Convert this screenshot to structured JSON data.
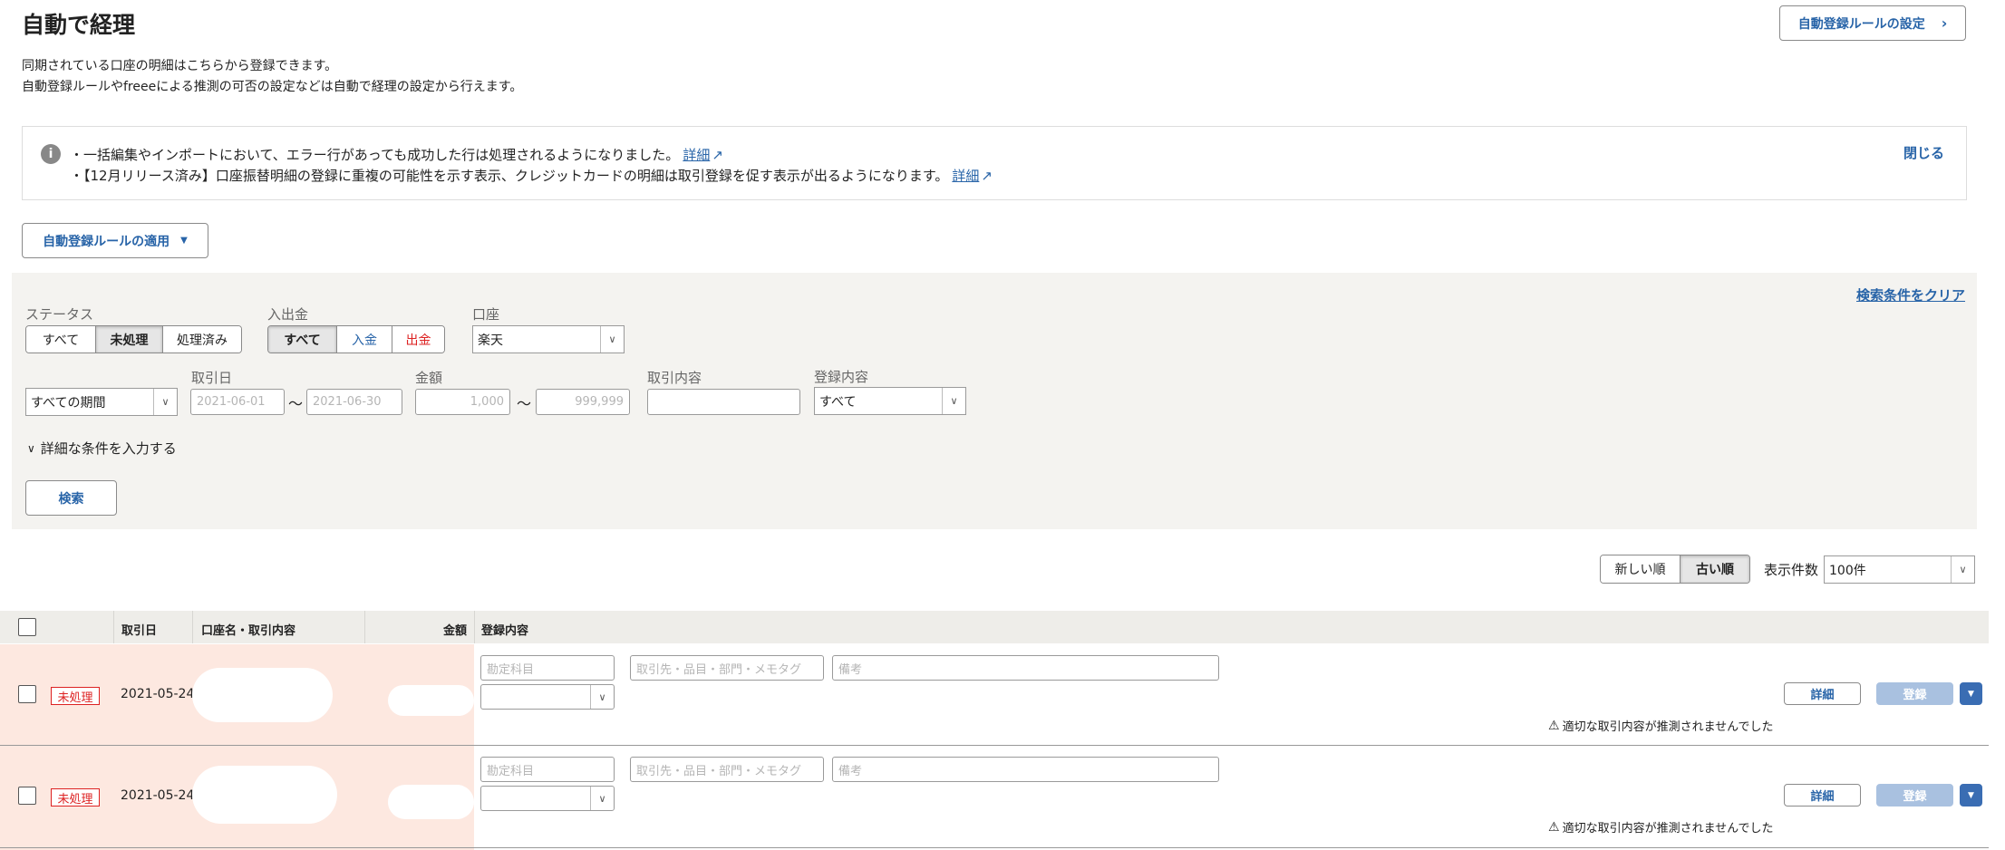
{
  "header": {
    "title": "自動で経理",
    "desc1": "同期されている口座の明細はこちらから登録できます。",
    "desc2": "自動登録ルールやfreeeによる推測の可否の設定などは自動で経理の設定から行えます。",
    "rule_settings_button": "自動登録ルールの設定"
  },
  "notice": {
    "line1": "・一括編集やインポートにおいて、エラー行があっても成功した行は処理されるようになりました。",
    "line2": "・【12月リリース済み】口座振替明細の登録に重複の可能性を示す表示、クレジットカードの明細は取引登録を促す表示が出るようになります。",
    "detail_link": "詳細",
    "close": "閉じる"
  },
  "apply_rules_button": "自動登録ルールの適用",
  "search": {
    "clear": "検索条件をクリア",
    "status_label": "ステータス",
    "status_options": [
      "すべて",
      "未処理",
      "処理済み"
    ],
    "io_label": "入出金",
    "io_options": [
      "すべて",
      "入金",
      "出金"
    ],
    "account_label": "口座",
    "account_value": "楽天",
    "period_value": "すべての期間",
    "date_label": "取引日",
    "date_from_placeholder": "2021-06-01",
    "date_to_placeholder": "2021-06-30",
    "tilde": "〜",
    "amount_label": "金額",
    "amount_from_placeholder": "1,000",
    "amount_to_placeholder": "999,999",
    "content_label": "取引内容",
    "reg_label": "登録内容",
    "reg_value": "すべて",
    "advanced": "詳細な条件を入力する",
    "search_button": "検索"
  },
  "sort": {
    "newest": "新しい順",
    "oldest": "古い順",
    "count_label": "表示件数",
    "count_value": "100件"
  },
  "table": {
    "headers": [
      "取引日",
      "口座名・取引内容",
      "金額",
      "登録内容"
    ],
    "rows": [
      {
        "status": "未処理",
        "date": "2021-05-24",
        "account_placeholder": "勘定科目",
        "partner_placeholder": "取引先・品目・部門・メモタグ",
        "note_placeholder": "備考",
        "detail_button": "詳細",
        "register_button": "登録",
        "warning": "適切な取引内容が推測されませんでした"
      },
      {
        "status": "未処理",
        "date": "2021-05-24",
        "account_placeholder": "勘定科目",
        "partner_placeholder": "取引先・品目・部門・メモタグ",
        "note_placeholder": "備考",
        "detail_button": "詳細",
        "register_button": "登録",
        "warning": "適切な取引内容が推測されませんでした"
      }
    ]
  }
}
